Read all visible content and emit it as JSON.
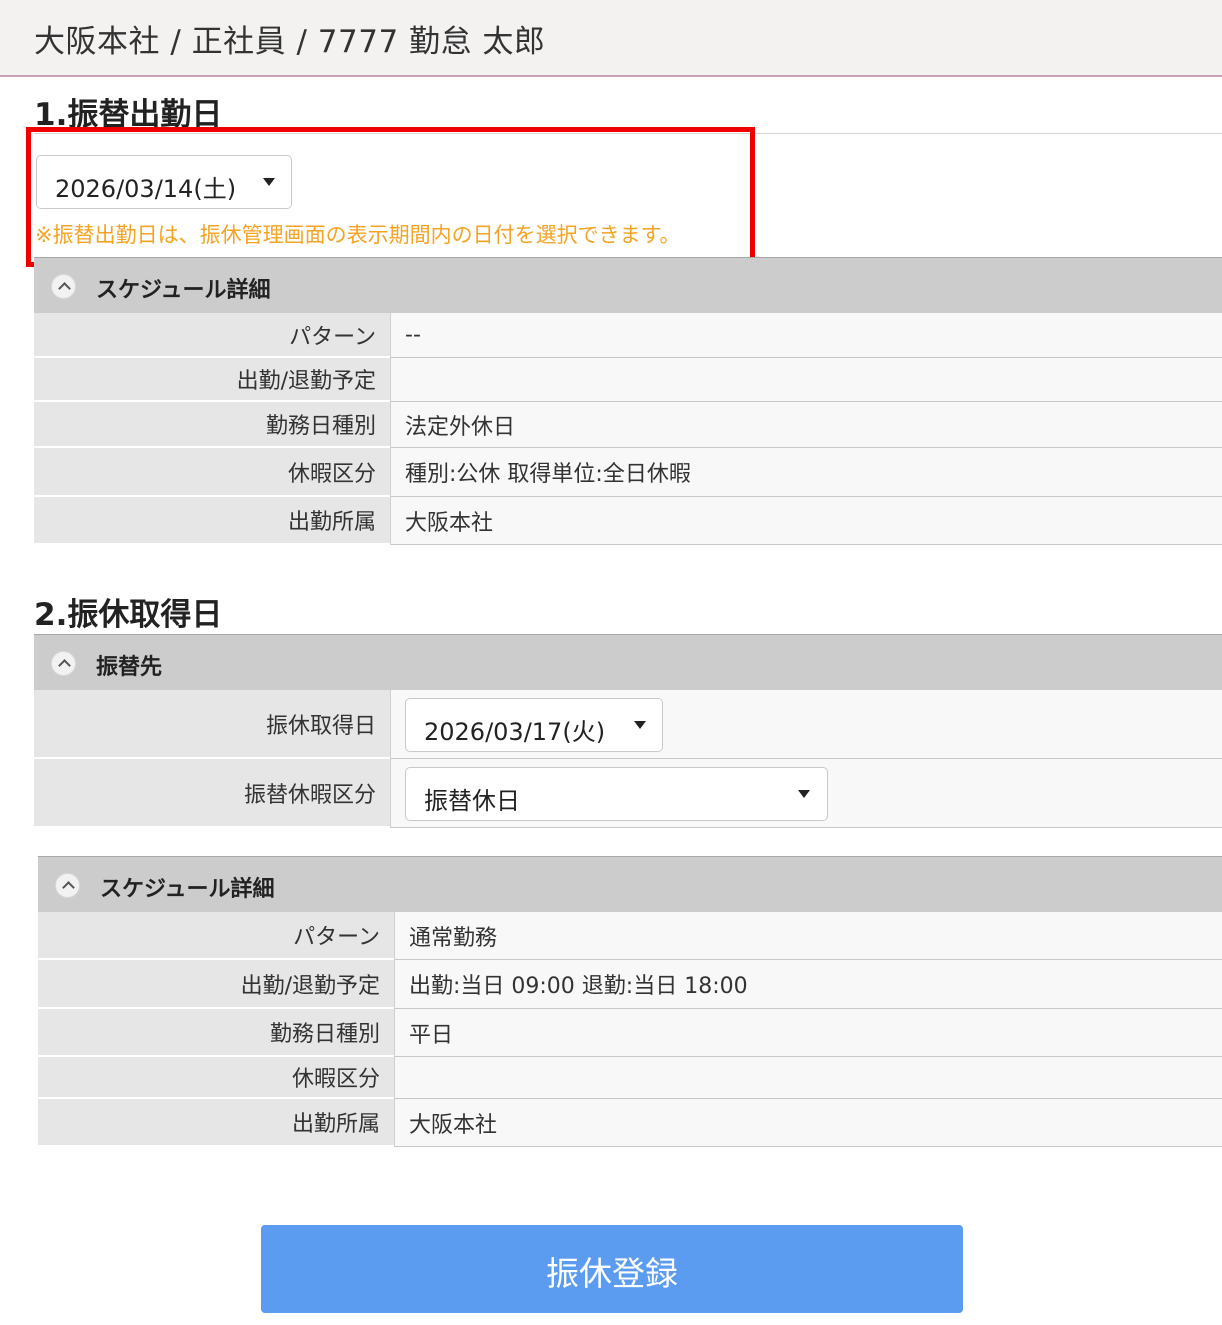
{
  "header": {
    "breadcrumb": "大阪本社 / 正社員 / 7777 勤怠 太郎"
  },
  "section1": {
    "title": "1.振替出勤日",
    "date_select": {
      "value": "2026/03/14(土)"
    },
    "note": "※振替出勤日は、振休管理画面の表示期間内の日付を選択できます。",
    "schedule": {
      "title": "スケジュール詳細",
      "rows": [
        {
          "label": "パターン",
          "value": "--"
        },
        {
          "label": "出勤/退勤予定",
          "value": ""
        },
        {
          "label": "勤務日種別",
          "value": "法定外休日"
        },
        {
          "label": "休暇区分",
          "value": "種別:公休 取得単位:全日休暇"
        },
        {
          "label": "出勤所属",
          "value": "大阪本社"
        }
      ]
    }
  },
  "section2": {
    "title": "2.振休取得日",
    "transfer": {
      "title": "振替先",
      "date_label": "振休取得日",
      "date_value": "2026/03/17(火)",
      "leave_label": "振替休暇区分",
      "leave_value": "振替休日"
    },
    "schedule": {
      "title": "スケジュール詳細",
      "rows": [
        {
          "label": "パターン",
          "value": "通常勤務"
        },
        {
          "label": "出勤/退勤予定",
          "value": "出勤:当日 09:00 退勤:当日 18:00"
        },
        {
          "label": "勤務日種別",
          "value": "平日"
        },
        {
          "label": "休暇区分",
          "value": ""
        },
        {
          "label": "出勤所属",
          "value": "大阪本社"
        }
      ]
    }
  },
  "submit": {
    "label": "振休登録"
  },
  "colors": {
    "accent": "#5b9cf0",
    "note": "#f5a322",
    "highlight": "#ee0000"
  }
}
